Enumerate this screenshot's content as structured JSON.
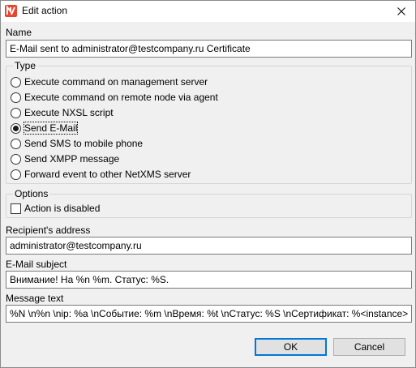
{
  "window": {
    "title": "Edit action",
    "app_icon": "netxms-logo-icon",
    "close_icon": "close-icon",
    "accent_color": "#0078d7",
    "logo_color": "#e8462d"
  },
  "name": {
    "label": "Name",
    "value": "E-Mail sent to administrator@testcompany.ru Certificate"
  },
  "type": {
    "label": "Type",
    "options": [
      {
        "label": "Execute command on management server",
        "checked": false
      },
      {
        "label": "Execute command on remote node via agent",
        "checked": false
      },
      {
        "label": "Execute NXSL script",
        "checked": false
      },
      {
        "label": "Send E-Mail",
        "checked": true
      },
      {
        "label": "Send SMS to mobile phone",
        "checked": false
      },
      {
        "label": "Send XMPP message",
        "checked": false
      },
      {
        "label": "Forward event to other NetXMS server",
        "checked": false
      }
    ]
  },
  "options": {
    "label": "Options",
    "action_disabled_label": "Action is disabled",
    "action_disabled_checked": false
  },
  "recipient": {
    "label": "Recipient's address",
    "value": "administrator@testcompany.ru"
  },
  "subject": {
    "label": "E-Mail subject",
    "value": "Внимание! На %n %m. Статус: %S."
  },
  "message": {
    "label": "Message text",
    "value": "%N \\n%n \\nip: %a \\nСобытие: %m \\nВремя: %t \\nСтатус: %S \\nСертификат: %<instance>"
  },
  "buttons": {
    "ok": "OK",
    "cancel": "Cancel"
  }
}
